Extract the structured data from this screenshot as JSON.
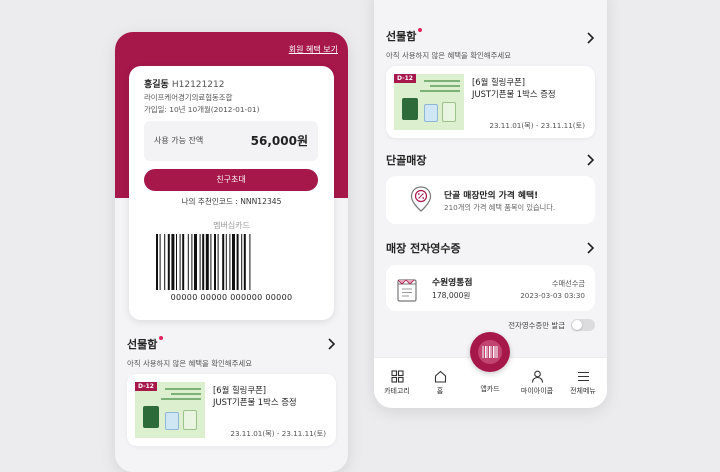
{
  "left_screen": {
    "benefits_link": "회원 혜택 보기",
    "user_name": "홍길동",
    "user_id": "H12121212",
    "union_name": "라이프케어경기의료협동조합",
    "join_info": "가입일: 10년 10개월(2012-01-01)",
    "balance_label": "사용 가능 잔액",
    "balance_value": "56,000원",
    "invite_button": "친구초대",
    "referral_code": "나의 추천인코드 : NNN12345",
    "membership_label": "멤버십카드",
    "barcode_number": "00000 00000 000000 00000",
    "gift_title": "선물함",
    "gift_subtitle": "아직 사용하지 않은 혜택을 확인해주세요",
    "coupon": {
      "badge": "D-12",
      "title_line1": "[6월 힐링쿠폰]",
      "title_line2": "JUST기픈물 1박스 증정",
      "dates": "23.11.01(목) - 23.11.11(토)"
    }
  },
  "right_screen": {
    "gift_title": "선물함",
    "gift_subtitle": "아직 사용하지 않은 혜택을 확인해주세요",
    "coupon": {
      "badge": "D-12",
      "title_line1": "[6월 힐링쿠폰]",
      "title_line2": "JUST기픈물 1박스 증정",
      "dates": "23.11.01(목) - 23.11.11(토)"
    },
    "regular_store_title": "단골매장",
    "regular_store_card_title": "단골 매장만의 가격 혜택!",
    "regular_store_card_sub": "210개의 가격 혜택 품목이 있습니다.",
    "receipt_title": "매장 전자영수증",
    "receipt": {
      "store": "수원영통점",
      "amount": "178,000원",
      "type": "수매선수금",
      "datetime": "2023-03-03 03:30"
    },
    "toggle_label": "전자영수증만 발급",
    "tabs": [
      "카테고리",
      "홈",
      "앱카드",
      "마이아이쿱",
      "전체메뉴"
    ]
  },
  "colors": {
    "accent": "#a6174a",
    "dot": "#e0245e"
  }
}
